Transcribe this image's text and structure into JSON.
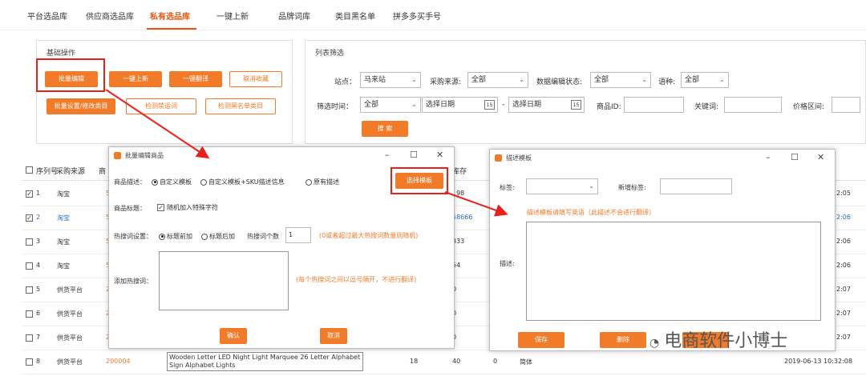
{
  "tabs": [
    "平台选品库",
    "供应商选品库",
    "私有选品库",
    "一键上新",
    "品牌词库",
    "类目黑名单",
    "拼多多买手号"
  ],
  "basic": {
    "title": "基础操作",
    "b1": "批量编辑",
    "b2": "一键上新",
    "b3": "一键翻译",
    "b4": "取消收藏",
    "b5": "批量设置/修改类目",
    "b6": "检测禁运词",
    "b7": "检测黑名单类目"
  },
  "filter": {
    "title": "列表筛选",
    "site_label": "站点：",
    "site_value": "马来站",
    "source_label": "采购来源:",
    "source_value": "全部",
    "edit_label": "数据编辑状态:",
    "edit_value": "全部",
    "lang_label": "语种:",
    "lang_value": "全部",
    "time_label": "筛选时间：",
    "time_value": "全部",
    "date1": "选择日期",
    "dash": "-",
    "date2": "选择日期",
    "cal_text": "15",
    "pid_label": "商品ID:",
    "kw_label": "关键词:",
    "price_label": "价格区间:",
    "search": "搜 索"
  },
  "table": {
    "header": [
      "序列号",
      "采购来源",
      "商",
      "库存"
    ],
    "rows": [
      {
        "no": "1",
        "checked": true,
        "src": "淘宝",
        "code": "5",
        "stock": "198",
        "time": "2:05"
      },
      {
        "no": "2",
        "checked": true,
        "src": "淘宝",
        "code": "5",
        "stock": "58666",
        "time": "2:06"
      },
      {
        "no": "3",
        "checked": false,
        "src": "淘宝",
        "code": "5",
        "stock": "333",
        "time": "2:06"
      },
      {
        "no": "4",
        "checked": false,
        "src": "淘宝",
        "code": "5",
        "stock": "54",
        "time": "2:06"
      },
      {
        "no": "5",
        "checked": false,
        "src": "供货平台",
        "code": "2",
        "stock": "0",
        "time": "2:07"
      },
      {
        "no": "6",
        "checked": false,
        "src": "供货平台",
        "code": "2",
        "stock": "0",
        "time": "2:07"
      },
      {
        "no": "7",
        "checked": false,
        "src": "供货平台",
        "code": "2",
        "stock": "0",
        "time": "2:07"
      },
      {
        "no": "8",
        "checked": false,
        "src": "供货平台",
        "code": "200004",
        "stock": "40",
        "time": "2019-06-13 10:32:08"
      }
    ],
    "row8_title": "Wooden Letter LED Night Light Marquee 26 Letter Alphabet Sign Alphabet Lights",
    "row8_num": "18",
    "row8_zero": "0",
    "row8_lang": "简体"
  },
  "dlg1": {
    "title": "批量编辑商品",
    "desc_label": "商品描述：",
    "opt1": "自定义模板",
    "opt2": "自定义模板+SKU描述信息",
    "opt3": "原有描述",
    "pick": "选择模板",
    "title_label": "商品标题：",
    "rand": "随机加入特殊字符",
    "hot_label": "热搜词设置：",
    "hot1": "标题前加",
    "hot2": "标题后加",
    "count_label": "热搜词个数",
    "count_val": "1",
    "count_note": "(0或者超过最大热搜词数量则随机)",
    "add_label": "添加热搜词：",
    "add_note": "(每个热搜词之间以逗号隔开，不进行翻译)",
    "ok": "确认",
    "cancel": "取消"
  },
  "dlg2": {
    "title": "描述模板",
    "tag_label": "标签:",
    "new_label": "新增标签:",
    "note": "描述模板请填写英语（此描述不会进行翻译）",
    "desc_label": "描述:",
    "save": "保存",
    "del": "删除"
  },
  "watermark": "电商软件小博士",
  "colors": {
    "accent": "#f27b2a",
    "highlight": "#e8211b"
  }
}
